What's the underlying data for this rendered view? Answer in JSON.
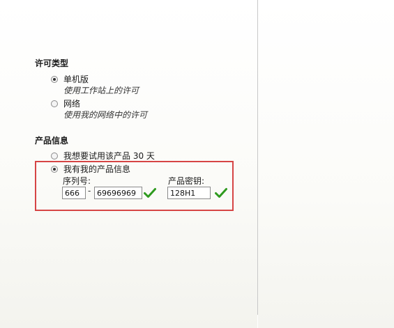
{
  "license_type": {
    "title": "许可类型",
    "options": [
      {
        "label": "单机版",
        "description": "使用工作站上的许可",
        "selected": true
      },
      {
        "label": "网络",
        "description": "使用我的网络中的许可",
        "selected": false
      }
    ]
  },
  "product_info": {
    "title": "产品信息",
    "trial_option": {
      "label": "我想要试用该产品 30 天",
      "selected": false
    },
    "have_info_option": {
      "label": "我有我的产品信息",
      "selected": true
    },
    "serial_label": "序列号:",
    "serial_prefix": "666",
    "serial_separator": "-",
    "serial_number": "69696969",
    "product_key_label": "产品密钥:",
    "product_key": "128H1"
  },
  "icons": {
    "valid": "check-icon"
  },
  "colors": {
    "highlight": "#d64545",
    "check": "#2e9a1e"
  }
}
